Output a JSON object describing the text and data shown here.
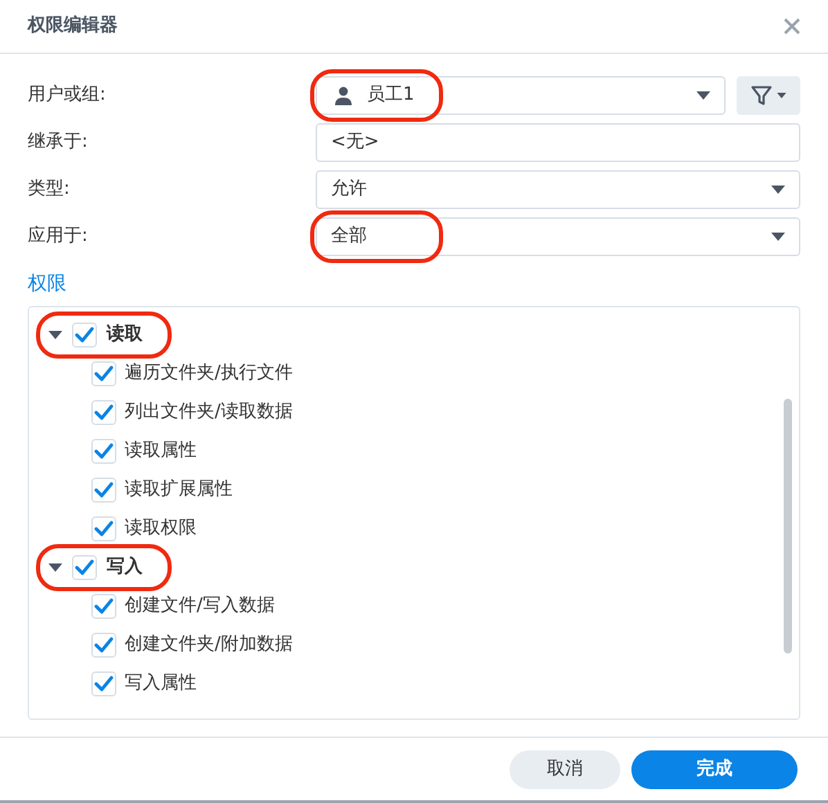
{
  "window": {
    "title": "权限编辑器"
  },
  "form": [
    {
      "kind": "user",
      "label": "用户或组:",
      "value": "员工1",
      "highlighted": true
    },
    {
      "kind": "text",
      "label": "继承于:",
      "value": "<无>",
      "highlighted": false
    },
    {
      "kind": "select",
      "label": "类型:",
      "value": "允许",
      "highlighted": false
    },
    {
      "kind": "select",
      "label": "应用于:",
      "value": "全部",
      "highlighted": true
    }
  ],
  "permissions": {
    "title": "权限",
    "groups": [
      {
        "label": "读取",
        "checked": true,
        "expanded": true,
        "highlighted": true,
        "children": [
          {
            "label": "遍历文件夹/执行文件",
            "checked": true
          },
          {
            "label": "列出文件夹/读取数据",
            "checked": true
          },
          {
            "label": "读取属性",
            "checked": true
          },
          {
            "label": "读取扩展属性",
            "checked": true
          },
          {
            "label": "读取权限",
            "checked": true
          }
        ]
      },
      {
        "label": "写入",
        "checked": true,
        "expanded": true,
        "highlighted": true,
        "children": [
          {
            "label": "创建文件/写入数据",
            "checked": true
          },
          {
            "label": "创建文件夹/附加数据",
            "checked": true
          },
          {
            "label": "写入属性",
            "checked": true
          }
        ]
      }
    ]
  },
  "buttons": [
    {
      "kind": "secondary",
      "label": "取消"
    },
    {
      "kind": "primary",
      "label": "完成"
    }
  ]
}
